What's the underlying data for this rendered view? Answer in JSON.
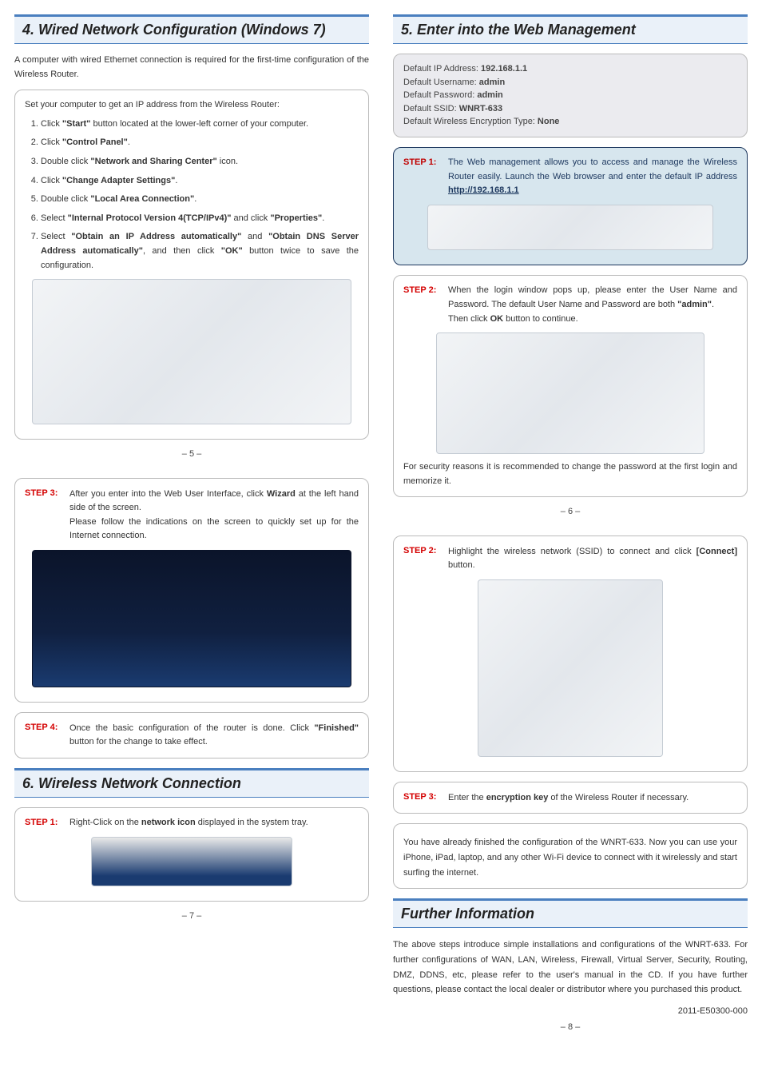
{
  "sec4": {
    "title": "4. Wired Network Configuration (Windows 7)",
    "intro": "A computer with wired Ethernet connection is required for the first-time configuration of the Wireless Router.",
    "boxlead": "Set your computer to get an IP address from the Wireless Router:",
    "s1a": "Click ",
    "s1b": "\"Start\"",
    "s1c": " button located at the lower-left corner of your computer.",
    "s2a": "Click ",
    "s2b": "\"Control Panel\"",
    "s2c": ".",
    "s3a": "Double click ",
    "s3b": "\"Network and Sharing Center\"",
    "s3c": " icon.",
    "s4a": "Click ",
    "s4b": "\"Change Adapter Settings\"",
    "s4c": ".",
    "s5a": "Double click ",
    "s5b": "\"Local Area Connection\"",
    "s5c": ".",
    "s6a": "Select ",
    "s6b": "\"Internal Protocol Version 4(TCP/IPv4)\"",
    "s6c": " and click ",
    "s6d": "\"Properties\"",
    "s6e": ".",
    "s7a": "Select ",
    "s7b": "\"Obtain an IP Address automatically\"",
    "s7c": " and ",
    "s7d": "\"Obtain DNS Server Address automatically\"",
    "s7e": ", and then click ",
    "s7f": "\"OK\"",
    "s7g": " button twice to save the configuration.",
    "pagenum": "– 5 –"
  },
  "sec5": {
    "title": "5. Enter into the Web Management",
    "d1": "Default IP Address: ",
    "d1v": "192.168.1.1",
    "d2": "Default Username: ",
    "d2v": "admin",
    "d3": "Default Password: ",
    "d3v": "admin",
    "d4": "Default SSID: ",
    "d4v": "WNRT-633",
    "d5": "Default Wireless Encryption Type: ",
    "d5v": "None",
    "s1l": "STEP 1:",
    "s1t": "The Web management allows you to access and manage the Wireless Router easily. Launch the Web browser and enter the default IP address ",
    "s1u": "http://192.168.1.1",
    "s2l": "STEP 2:",
    "s2a": "When the login window pops up, please enter the User Name and Password. The default User Name and Password are both ",
    "s2b": "\"admin\"",
    "s2c": ".",
    "s2d": "Then click ",
    "s2e": "OK",
    "s2f": " button to continue.",
    "note": "For security reasons it is recommended to change the password at the first login and memorize it.",
    "pagenum": "– 6 –"
  },
  "sec5b": {
    "s3l": "STEP 3:",
    "s3a": "After you enter into the Web User Interface, click ",
    "s3b": "Wizard",
    "s3c": " at the left hand side of the screen.",
    "s3d": "Please follow the indications on the screen to quickly set up for the Internet connection.",
    "s4l": "STEP 4:",
    "s4a": "Once the basic configuration of the router is done. Click ",
    "s4b": "\"Finished\"",
    "s4c": " button for the change to take effect."
  },
  "sec6": {
    "title": "6. Wireless Network Connection",
    "s1l": "STEP 1:",
    "s1a": "Right-Click on the ",
    "s1b": "network icon",
    "s1c": " displayed in the system tray.",
    "pagenum": "– 7 –"
  },
  "sec6b": {
    "s2l": "STEP 2:",
    "s2a": "Highlight the wireless network (SSID) to connect and click ",
    "s2b": "[Connect]",
    "s2c": " button.",
    "s3l": "STEP 3:",
    "s3a": "Enter the ",
    "s3b": "encryption key",
    "s3c": " of the Wireless Router if necessary.",
    "closing": "You have already finished the configuration of the WNRT-633. Now you can use your iPhone, iPad, laptop, and any other Wi-Fi device to connect with it wirelessly and start surfing the internet."
  },
  "further": {
    "title": "Further Information",
    "body": "The above steps introduce simple installations and configurations of the WNRT-633. For further configurations of WAN, LAN, Wireless, Firewall, Virtual Server, Security, Routing, DMZ, DDNS, etc, please refer to the user's manual in the CD. If you have further questions, please contact the local dealer or distributor where you purchased this product.",
    "partno": "2011-E50300-000",
    "pagenum": "– 8 –"
  }
}
